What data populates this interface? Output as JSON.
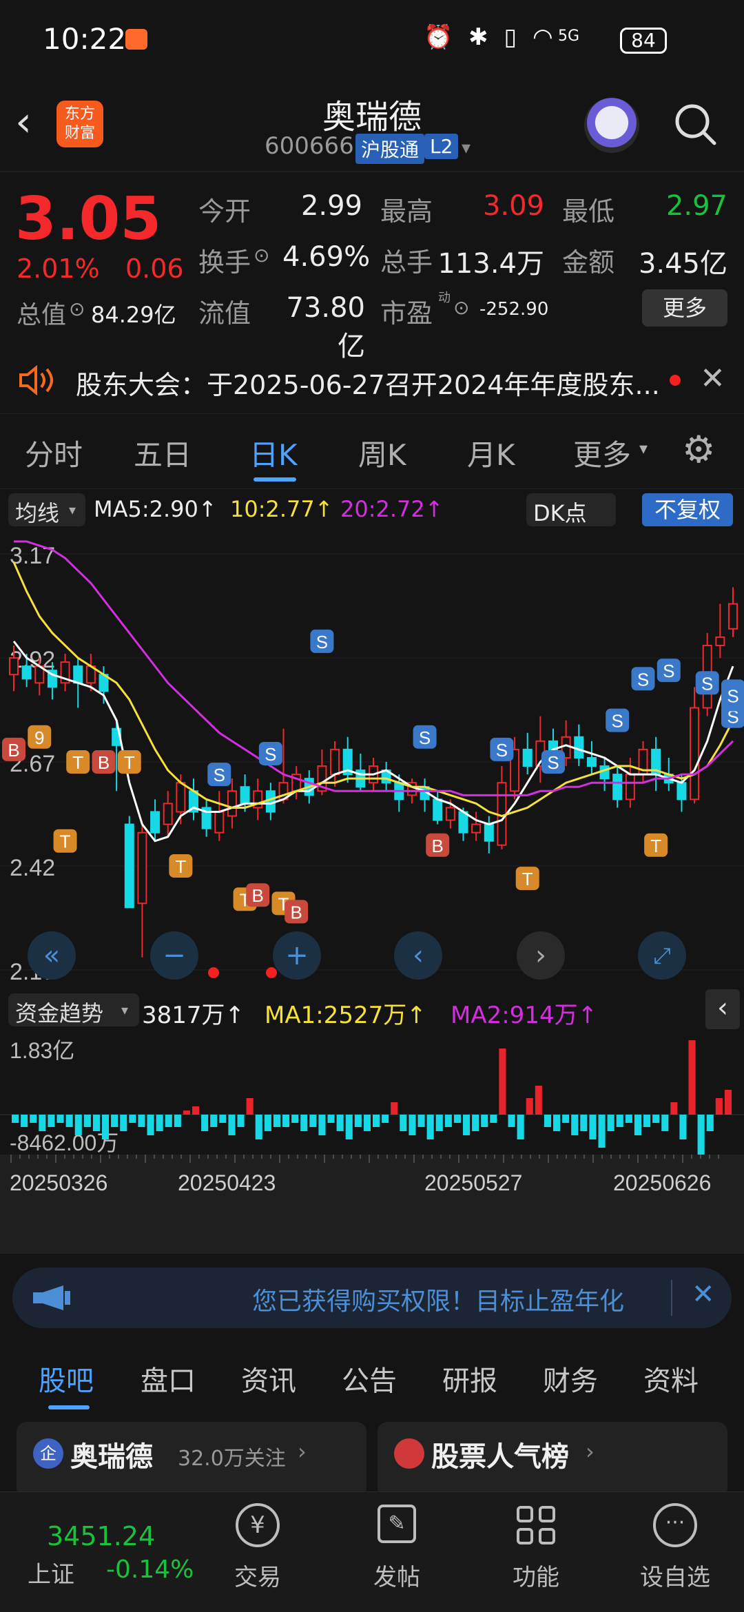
{
  "status_bar": {
    "time": "10:22",
    "network": "5G",
    "battery": "84"
  },
  "header": {
    "back_icon": "chevron-left-icon",
    "logo": "东方\n财富",
    "title": "奥瑞德",
    "code": "600666",
    "badge_shgt": "沪股通",
    "badge_l2": "L2"
  },
  "quote": {
    "price": "3.05",
    "change_pct": "2.01%",
    "change_val": "0.06",
    "open_label": "今开",
    "open": "2.99",
    "high_label": "最高",
    "high": "3.09",
    "low_label": "最低",
    "low": "2.97",
    "turnover_label": "换手",
    "turnover": "4.69%",
    "volume_label": "总手",
    "volume": "113.4万",
    "amount_label": "金额",
    "amount": "3.45亿",
    "mcap_label": "总值",
    "mcap": "84.29亿",
    "float_label": "流值",
    "float": "73.80亿",
    "pe_label": "市盈",
    "pe_super": "动",
    "pe": "-252.90",
    "more_button": "更多"
  },
  "notice": {
    "text": "股东大会：于2025-06-27召开2024年年度股东..."
  },
  "period_tabs": [
    "分时",
    "五日",
    "日K",
    "周K",
    "月K",
    "更多"
  ],
  "period_active": 2,
  "kline_bar": {
    "ma_select": "均线",
    "ma5": "MA5:2.90",
    "ma10": "10:2.77",
    "ma20": "20:2.72",
    "dk_button": "DK点",
    "fq_button": "不复权"
  },
  "kline": {
    "y_labels": [
      "3.17",
      "2.92",
      "2.67",
      "2.42",
      "2.17"
    ],
    "candles": [
      {
        "o": 2.88,
        "c": 2.92,
        "h": 2.95,
        "l": 2.84
      },
      {
        "o": 2.9,
        "c": 2.87,
        "h": 2.93,
        "l": 2.85
      },
      {
        "o": 2.86,
        "c": 2.9,
        "h": 2.92,
        "l": 2.83
      },
      {
        "o": 2.89,
        "c": 2.85,
        "h": 2.91,
        "l": 2.82
      },
      {
        "o": 2.86,
        "c": 2.91,
        "h": 2.93,
        "l": 2.84
      },
      {
        "o": 2.9,
        "c": 2.86,
        "h": 2.92,
        "l": 2.8
      },
      {
        "o": 2.86,
        "c": 2.9,
        "h": 2.93,
        "l": 2.84
      },
      {
        "o": 2.88,
        "c": 2.84,
        "h": 2.9,
        "l": 2.81
      },
      {
        "o": 2.75,
        "c": 2.71,
        "h": 2.77,
        "l": 2.6
      },
      {
        "o": 2.52,
        "c": 2.32,
        "h": 2.54,
        "l": 2.32
      },
      {
        "o": 2.33,
        "c": 2.5,
        "h": 2.52,
        "l": 2.2
      },
      {
        "o": 2.55,
        "c": 2.5,
        "h": 2.58,
        "l": 2.48
      },
      {
        "o": 2.52,
        "c": 2.57,
        "h": 2.6,
        "l": 2.49
      },
      {
        "o": 2.55,
        "c": 2.62,
        "h": 2.64,
        "l": 2.52
      },
      {
        "o": 2.6,
        "c": 2.55,
        "h": 2.63,
        "l": 2.53
      },
      {
        "o": 2.56,
        "c": 2.51,
        "h": 2.58,
        "l": 2.49
      },
      {
        "o": 2.5,
        "c": 2.55,
        "h": 2.6,
        "l": 2.48
      },
      {
        "o": 2.54,
        "c": 2.6,
        "h": 2.63,
        "l": 2.51
      },
      {
        "o": 2.61,
        "c": 2.57,
        "h": 2.64,
        "l": 2.55
      },
      {
        "o": 2.56,
        "c": 2.6,
        "h": 2.63,
        "l": 2.53
      },
      {
        "o": 2.6,
        "c": 2.55,
        "h": 2.62,
        "l": 2.53
      },
      {
        "o": 2.58,
        "c": 2.62,
        "h": 2.75,
        "l": 2.57
      },
      {
        "o": 2.6,
        "c": 2.64,
        "h": 2.66,
        "l": 2.58
      },
      {
        "o": 2.63,
        "c": 2.59,
        "h": 2.65,
        "l": 2.57
      },
      {
        "o": 2.6,
        "c": 2.66,
        "h": 2.7,
        "l": 2.59
      },
      {
        "o": 2.64,
        "c": 2.7,
        "h": 2.72,
        "l": 2.61
      },
      {
        "o": 2.7,
        "c": 2.64,
        "h": 2.73,
        "l": 2.62
      },
      {
        "o": 2.65,
        "c": 2.61,
        "h": 2.69,
        "l": 2.6
      },
      {
        "o": 2.62,
        "c": 2.66,
        "h": 2.68,
        "l": 2.6
      },
      {
        "o": 2.65,
        "c": 2.62,
        "h": 2.67,
        "l": 2.6
      },
      {
        "o": 2.62,
        "c": 2.58,
        "h": 2.64,
        "l": 2.55
      },
      {
        "o": 2.59,
        "c": 2.62,
        "h": 2.63,
        "l": 2.57
      },
      {
        "o": 2.61,
        "c": 2.58,
        "h": 2.63,
        "l": 2.55
      },
      {
        "o": 2.58,
        "c": 2.53,
        "h": 2.6,
        "l": 2.52
      },
      {
        "o": 2.53,
        "c": 2.56,
        "h": 2.58,
        "l": 2.51
      },
      {
        "o": 2.55,
        "c": 2.5,
        "h": 2.56,
        "l": 2.48
      },
      {
        "o": 2.5,
        "c": 2.52,
        "h": 2.55,
        "l": 2.48
      },
      {
        "o": 2.52,
        "c": 2.48,
        "h": 2.54,
        "l": 2.45
      },
      {
        "o": 2.47,
        "c": 2.62,
        "h": 2.66,
        "l": 2.46
      },
      {
        "o": 2.6,
        "c": 2.7,
        "h": 2.73,
        "l": 2.58
      },
      {
        "o": 2.7,
        "c": 2.66,
        "h": 2.74,
        "l": 2.64
      },
      {
        "o": 2.66,
        "c": 2.72,
        "h": 2.78,
        "l": 2.62
      },
      {
        "o": 2.72,
        "c": 2.68,
        "h": 2.75,
        "l": 2.66
      },
      {
        "o": 2.68,
        "c": 2.73,
        "h": 2.77,
        "l": 2.66
      },
      {
        "o": 2.73,
        "c": 2.68,
        "h": 2.76,
        "l": 2.66
      },
      {
        "o": 2.68,
        "c": 2.66,
        "h": 2.72,
        "l": 2.64
      },
      {
        "o": 2.66,
        "c": 2.63,
        "h": 2.68,
        "l": 2.6
      },
      {
        "o": 2.64,
        "c": 2.58,
        "h": 2.66,
        "l": 2.56
      },
      {
        "o": 2.58,
        "c": 2.64,
        "h": 2.68,
        "l": 2.56
      },
      {
        "o": 2.64,
        "c": 2.7,
        "h": 2.72,
        "l": 2.62
      },
      {
        "o": 2.7,
        "c": 2.64,
        "h": 2.73,
        "l": 2.6
      },
      {
        "o": 2.64,
        "c": 2.62,
        "h": 2.68,
        "l": 2.6
      },
      {
        "o": 2.62,
        "c": 2.58,
        "h": 2.64,
        "l": 2.55
      },
      {
        "o": 2.58,
        "c": 2.8,
        "h": 2.85,
        "l": 2.57
      },
      {
        "o": 2.8,
        "c": 2.95,
        "h": 2.98,
        "l": 2.78
      },
      {
        "o": 2.95,
        "c": 2.97,
        "h": 3.05,
        "l": 2.92
      },
      {
        "o": 2.99,
        "c": 3.05,
        "h": 3.09,
        "l": 2.97
      }
    ],
    "ma5": [
      2.96,
      2.92,
      2.9,
      2.88,
      2.87,
      2.86,
      2.85,
      2.83,
      2.77,
      2.62,
      2.52,
      2.48,
      2.49,
      2.54,
      2.56,
      2.55,
      2.55,
      2.56,
      2.57,
      2.57,
      2.57,
      2.58,
      2.6,
      2.6,
      2.62,
      2.64,
      2.65,
      2.64,
      2.64,
      2.65,
      2.63,
      2.61,
      2.6,
      2.58,
      2.57,
      2.55,
      2.53,
      2.52,
      2.53,
      2.57,
      2.62,
      2.67,
      2.7,
      2.71,
      2.7,
      2.69,
      2.68,
      2.66,
      2.64,
      2.64,
      2.64,
      2.63,
      2.62,
      2.65,
      2.72,
      2.82,
      2.9
    ],
    "ma10": [
      3.15,
      3.08,
      3.02,
      2.98,
      2.95,
      2.92,
      2.9,
      2.88,
      2.86,
      2.82,
      2.76,
      2.7,
      2.65,
      2.62,
      2.6,
      2.58,
      2.57,
      2.56,
      2.56,
      2.57,
      2.58,
      2.59,
      2.6,
      2.61,
      2.62,
      2.62,
      2.63,
      2.63,
      2.63,
      2.63,
      2.62,
      2.61,
      2.61,
      2.6,
      2.59,
      2.58,
      2.57,
      2.55,
      2.54,
      2.55,
      2.56,
      2.58,
      2.6,
      2.62,
      2.63,
      2.64,
      2.65,
      2.66,
      2.66,
      2.65,
      2.65,
      2.64,
      2.63,
      2.64,
      2.66,
      2.71,
      2.77
    ],
    "ma20": [
      3.2,
      3.2,
      3.19,
      3.18,
      3.16,
      3.13,
      3.1,
      3.06,
      3.02,
      2.98,
      2.94,
      2.9,
      2.86,
      2.83,
      2.8,
      2.77,
      2.74,
      2.72,
      2.7,
      2.68,
      2.66,
      2.64,
      2.63,
      2.62,
      2.61,
      2.6,
      2.6,
      2.6,
      2.6,
      2.6,
      2.6,
      2.6,
      2.6,
      2.6,
      2.6,
      2.59,
      2.59,
      2.59,
      2.59,
      2.59,
      2.59,
      2.6,
      2.6,
      2.61,
      2.61,
      2.62,
      2.62,
      2.62,
      2.62,
      2.62,
      2.63,
      2.63,
      2.64,
      2.64,
      2.66,
      2.69,
      2.72
    ],
    "markers": [
      {
        "i": 0,
        "t": "B",
        "p": 2.7
      },
      {
        "i": 2,
        "t": "9",
        "p": 2.73
      },
      {
        "i": 4,
        "t": "T",
        "p": 2.48
      },
      {
        "i": 5,
        "t": "T",
        "p": 2.67
      },
      {
        "i": 7,
        "t": "B",
        "p": 2.67
      },
      {
        "i": 9,
        "t": "T",
        "p": 2.67
      },
      {
        "i": 13,
        "t": "T",
        "p": 2.42
      },
      {
        "i": 16,
        "t": "S",
        "p": 2.64
      },
      {
        "i": 18,
        "t": "T",
        "p": 2.34
      },
      {
        "i": 19,
        "t": "B",
        "p": 2.35
      },
      {
        "i": 20,
        "t": "S",
        "p": 2.69
      },
      {
        "i": 21,
        "t": "T",
        "p": 2.33
      },
      {
        "i": 22,
        "t": "B",
        "p": 2.31
      },
      {
        "i": 24,
        "t": "S",
        "p": 2.96
      },
      {
        "i": 32,
        "t": "S",
        "p": 2.73
      },
      {
        "i": 33,
        "t": "B",
        "p": 2.47
      },
      {
        "i": 38,
        "t": "S",
        "p": 2.7
      },
      {
        "i": 40,
        "t": "T",
        "p": 2.39
      },
      {
        "i": 42,
        "t": "S",
        "p": 2.67
      },
      {
        "i": 47,
        "t": "S",
        "p": 2.77
      },
      {
        "i": 49,
        "t": "S",
        "p": 2.87
      },
      {
        "i": 50,
        "t": "T",
        "p": 2.47
      },
      {
        "i": 51,
        "t": "S",
        "p": 2.89
      },
      {
        "i": 54,
        "t": "S",
        "p": 2.86
      },
      {
        "i": 56,
        "t": "S",
        "p": 2.78
      },
      {
        "i": 58,
        "t": "S",
        "p": 2.82
      },
      {
        "i": 60,
        "t": "S",
        "p": 2.84
      },
      {
        "i": 62,
        "t": "S",
        "p": 2.83
      }
    ]
  },
  "fund_bar": {
    "select": "资金趋势",
    "value": "3817万",
    "ma1": "MA1:2527万",
    "ma2": "MA2:914万"
  },
  "fund": {
    "y_top": "1.83亿",
    "y_bottom": "-8462.00万",
    "bars": [
      -2,
      -3,
      -2,
      -4,
      -3,
      -2,
      -3,
      -5,
      -3,
      -4,
      -6,
      -3,
      -4,
      -2,
      -3,
      -5,
      -4,
      -3,
      -3,
      1,
      2,
      -4,
      -3,
      -2,
      -5,
      -3,
      4,
      -6,
      -4,
      -3,
      -3,
      -2,
      -4,
      -3,
      -5,
      -2,
      -4,
      -6,
      -3,
      -4,
      -3,
      -2,
      3,
      -4,
      -5,
      -3,
      -6,
      -4,
      -3,
      -2,
      -5,
      -4,
      -3,
      -2,
      16,
      -3,
      -6,
      4,
      7,
      -3,
      -4,
      -2,
      -5,
      -4,
      -6,
      -8,
      -4,
      -3,
      -2,
      -5,
      -3,
      -2,
      -4,
      3,
      -6,
      18,
      -14,
      -4,
      4,
      6
    ],
    "x_labels": [
      "20250326",
      "20250423",
      "20250527",
      "20250626"
    ]
  },
  "banner": {
    "text": "您已获得购买权限！目标止盈年化"
  },
  "bottom_tabs": [
    "股吧",
    "盘口",
    "资讯",
    "公告",
    "研报",
    "财务",
    "资料"
  ],
  "bottom_active": 0,
  "cards": [
    {
      "title": "奥瑞德",
      "sub": "32.0万关注"
    },
    {
      "title": "股票人气榜"
    }
  ],
  "nav": {
    "index_value": "3451.24",
    "index_name": "上证",
    "index_change": "-0.14%",
    "items": [
      "交易",
      "发帖",
      "功能",
      "设自选"
    ]
  }
}
